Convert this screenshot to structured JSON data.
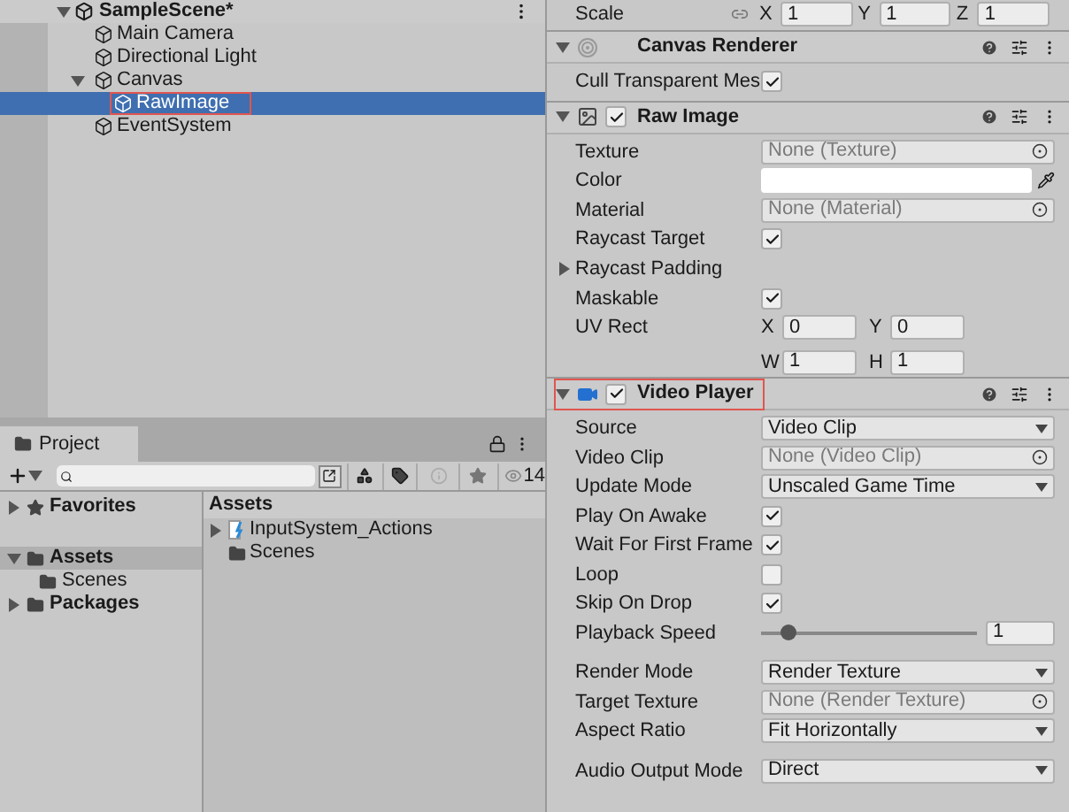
{
  "hierarchy": {
    "scene": "SampleScene*",
    "items": [
      {
        "name": "Main Camera",
        "selected": false,
        "outlined": false
      },
      {
        "name": "Directional Light",
        "selected": false,
        "outlined": false
      },
      {
        "name": "Canvas",
        "selected": false,
        "outlined": false,
        "expanded": true,
        "children": [
          {
            "name": "RawImage",
            "selected": true,
            "outlined": true
          }
        ]
      },
      {
        "name": "EventSystem",
        "selected": false,
        "outlined": false
      }
    ]
  },
  "project": {
    "tab": "Project",
    "count": "14",
    "sidebar": [
      {
        "label": "Favorites",
        "kind": "favorites",
        "expanded": false,
        "selected": false
      },
      {
        "label": "Assets",
        "kind": "folder",
        "expanded": true,
        "selected": true,
        "children": [
          {
            "label": "Scenes",
            "kind": "folder",
            "selected": false
          }
        ]
      },
      {
        "label": "Packages",
        "kind": "folder",
        "expanded": false,
        "selected": false
      }
    ],
    "assets_header": "Assets",
    "assets": [
      {
        "label": "InputSystem_Actions",
        "kind": "input-actions",
        "expandable": true
      },
      {
        "label": "Scenes",
        "kind": "folder",
        "expandable": false
      }
    ]
  },
  "inspector": {
    "scale": {
      "label": "Scale",
      "fields": [
        {
          "axis": "X",
          "value": "1"
        },
        {
          "axis": "Y",
          "value": "1"
        },
        {
          "axis": "Z",
          "value": "1"
        }
      ]
    },
    "components": [
      {
        "kind": "canvas-renderer",
        "title": "Canvas Renderer",
        "expanded": true,
        "outlined": false,
        "sections": [
          [
            {
              "kind": "checkbox",
              "label": "Cull Transparent Mes",
              "checked": true
            }
          ]
        ]
      },
      {
        "kind": "raw-image",
        "title": "Raw Image",
        "enabled": true,
        "expanded": true,
        "outlined": false,
        "sections": [
          [
            {
              "kind": "object",
              "label": "Texture",
              "value": "None (Texture)"
            },
            {
              "kind": "color",
              "label": "Color",
              "color": "#ffffff"
            },
            {
              "kind": "object",
              "label": "Material",
              "value": "None (Material)"
            },
            {
              "kind": "checkbox",
              "label": "Raycast Target",
              "checked": true
            },
            {
              "kind": "foldout",
              "label": "Raycast Padding",
              "expanded": false
            },
            {
              "kind": "checkbox",
              "label": "Maskable",
              "checked": true
            },
            {
              "kind": "vector",
              "label": "UV Rect",
              "rows": [
                [
                  {
                    "axis": "X",
                    "value": "0"
                  },
                  {
                    "axis": "Y",
                    "value": "0"
                  }
                ],
                [
                  {
                    "axis": "W",
                    "value": "1"
                  },
                  {
                    "axis": "H",
                    "value": "1"
                  }
                ]
              ]
            }
          ]
        ]
      },
      {
        "kind": "video-player",
        "title": "Video Player",
        "enabled": true,
        "expanded": true,
        "outlined": true,
        "sections": [
          [
            {
              "kind": "dropdown",
              "label": "Source",
              "value": "Video Clip"
            },
            {
              "kind": "object",
              "label": "Video Clip",
              "value": "None (Video Clip)"
            },
            {
              "kind": "dropdown",
              "label": "Update Mode",
              "value": "Unscaled Game Time"
            },
            {
              "kind": "checkbox",
              "label": "Play On Awake",
              "checked": true
            },
            {
              "kind": "checkbox",
              "label": "Wait For First Frame",
              "checked": true
            },
            {
              "kind": "checkbox",
              "label": "Loop",
              "checked": false
            },
            {
              "kind": "checkbox",
              "label": "Skip On Drop",
              "checked": true
            },
            {
              "kind": "slider",
              "label": "Playback Speed",
              "level": 0.12,
              "value": "1"
            }
          ],
          [
            {
              "kind": "dropdown",
              "label": "Render Mode",
              "value": "Render Texture"
            },
            {
              "kind": "object",
              "label": "Target Texture",
              "value": "None (Render Texture)"
            },
            {
              "kind": "dropdown",
              "label": "Aspect Ratio",
              "value": "Fit Horizontally"
            }
          ],
          [
            {
              "kind": "dropdown",
              "label": "Audio Output Mode",
              "value": "Direct"
            }
          ]
        ]
      }
    ]
  }
}
